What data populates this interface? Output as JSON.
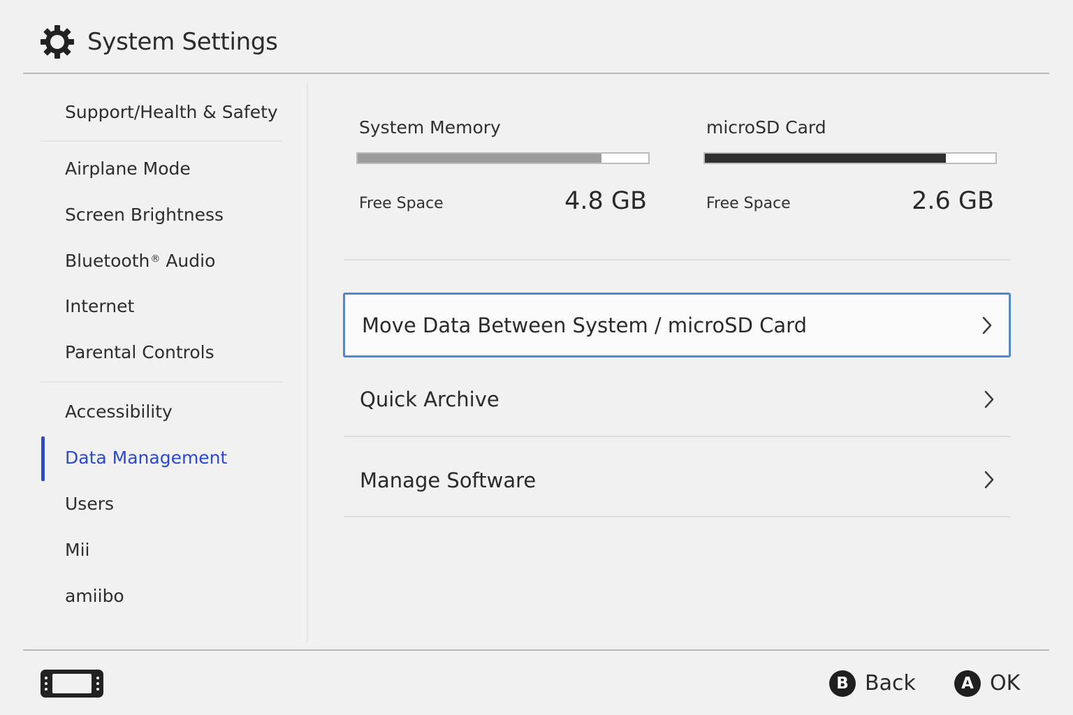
{
  "header": {
    "title": "System Settings",
    "icon": "gear-icon"
  },
  "sidebar": {
    "items": [
      {
        "label": "Support/Health & Safety"
      },
      {
        "label": "Airplane Mode"
      },
      {
        "label": "Screen Brightness"
      },
      {
        "label": "Bluetooth",
        "suffix_mark": "®",
        "suffix": " Audio"
      },
      {
        "label": "Internet"
      },
      {
        "label": "Parental Controls"
      },
      {
        "label": "Accessibility"
      },
      {
        "label": "Data Management",
        "selected": true
      },
      {
        "label": "Users"
      },
      {
        "label": "Mii"
      },
      {
        "label": "amiibo"
      }
    ]
  },
  "storage": {
    "system": {
      "label": "System Memory",
      "free_label": "Free Space",
      "free_value": "4.8 GB",
      "used_fraction": 0.84
    },
    "microsd": {
      "label": "microSD Card",
      "free_label": "Free Space",
      "free_value": "2.6 GB",
      "used_fraction": 0.83
    }
  },
  "menu": {
    "items": [
      {
        "label": "Move Data Between System / microSD Card",
        "focused": true
      },
      {
        "label": "Quick Archive"
      },
      {
        "label": "Manage Software"
      }
    ]
  },
  "footer": {
    "left_icon": "console-icon",
    "buttons": [
      {
        "glyph": "B",
        "label": "Back"
      },
      {
        "glyph": "A",
        "label": "OK"
      }
    ]
  },
  "colors": {
    "accent": "#2a49d6",
    "focus_border": "#4f86d8",
    "background": "#f1f1f1"
  }
}
